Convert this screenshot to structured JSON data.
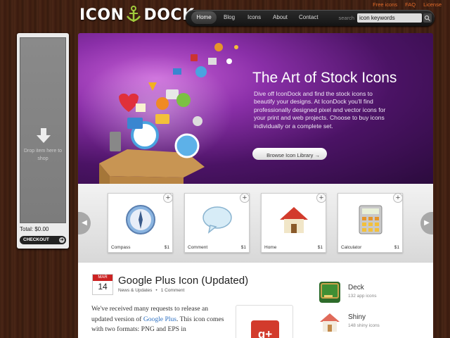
{
  "header": {
    "logo_left": "ICON",
    "logo_right": "DOCK",
    "top_links": [
      "Free icons",
      "FAQ",
      "License"
    ],
    "nav": [
      "Home",
      "Blog",
      "Icons",
      "About",
      "Contact"
    ],
    "search_label": "search",
    "search_value": "icon keywords"
  },
  "sidebar": {
    "drop_text": "Drop item here to shop",
    "total": "Total: $0.00",
    "checkout": "CHECKOUT"
  },
  "hero": {
    "title": "The Art of Stock Icons",
    "body": "Dive off IconDock and find the stock icons to beautify your designs. At IconDock you'll find professionally designed pixel and vector icons for your print and web projects. Choose to buy icons individually or a complete set.",
    "button": "Browse Icon Library →"
  },
  "carousel": {
    "items": [
      {
        "name": "Compass",
        "price": "$1"
      },
      {
        "name": "Comment",
        "price": "$1"
      },
      {
        "name": "Home",
        "price": "$1"
      },
      {
        "name": "Calculator",
        "price": "$1"
      }
    ],
    "prev": "◀",
    "next": "▶",
    "plus": "+"
  },
  "post": {
    "month": "MAR",
    "day": "14",
    "title": "Google Plus Icon (Updated)",
    "category": "News & Updates",
    "comments": "1 Comment",
    "body_1": "We've received many requests to release an updated version of ",
    "body_link": "Google Plus",
    "body_2": ". This icon comes with two formats: PNG and EPS in",
    "thumb_text": "g+"
  },
  "sets": [
    {
      "title": "Deck",
      "sub": "132 app icons"
    },
    {
      "title": "Shiny",
      "sub": "148 shiny icons"
    }
  ],
  "colors": {
    "accent": "#e26a2a",
    "link": "#2c6fc1",
    "hero": "#6a1f88"
  }
}
